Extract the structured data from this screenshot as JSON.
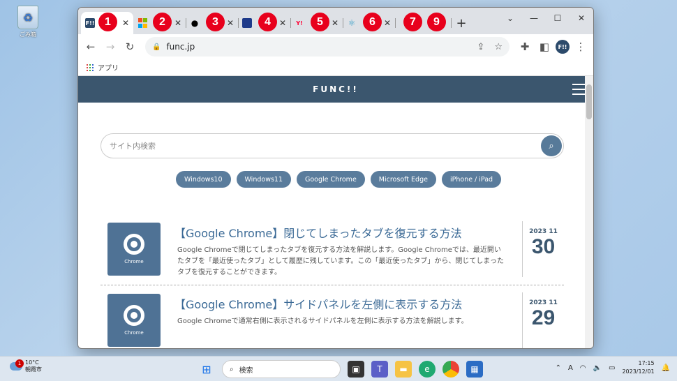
{
  "desktop": {
    "recycle_label": "ごみ箱"
  },
  "browser": {
    "tabs": [
      {
        "fav": "F!!",
        "color": "#2c4a6b",
        "badge": "1"
      },
      {
        "fav": "",
        "color": "#f25022",
        "badge": "2"
      },
      {
        "fav": "",
        "color": "#000000",
        "badge": "3"
      },
      {
        "fav": "",
        "color": "#1e3a8a",
        "badge": "4"
      },
      {
        "fav": "Y!",
        "color": "#ff0033",
        "badge": "5"
      },
      {
        "fav": "⚛",
        "color": "#61dafb",
        "badge": "6"
      },
      {
        "fav": "",
        "color": "#888888",
        "badge": "7"
      },
      {
        "fav": "",
        "color": "#888888",
        "badge": "9"
      }
    ],
    "new_tab": "+",
    "url": "func.jp",
    "bookmark_apps": "アプリ",
    "profile": "F!!"
  },
  "site": {
    "logo": "FUNC!!",
    "search_placeholder": "サイト内検索",
    "tags": [
      "Windows10",
      "Windows11",
      "Google Chrome",
      "Microsoft Edge",
      "iPhone / iPad"
    ],
    "articles": [
      {
        "title": "【Google Chrome】閉じてしまったタブを復元する方法",
        "desc": "Google Chromeで閉じてしまったタブを復元する方法を解説します。Google Chromeでは、最近開いたタブを「最近使ったタブ」として履歴に残しています。この「最近使ったタブ」から、閉じてしまったタブを復元することができます。",
        "ym": "2023 11",
        "day": "30",
        "thumb": "Chrome"
      },
      {
        "title": "【Google Chrome】サイドパネルを左側に表示する方法",
        "desc": "Google Chromeで通常右側に表示されるサイドパネルを左側に表示する方法を解説します。",
        "ym": "2023 11",
        "day": "29",
        "thumb": "Chrome"
      }
    ]
  },
  "taskbar": {
    "weather_temp": "10°C",
    "weather_city": "朝霞市",
    "weather_badge": "1",
    "search": "検索",
    "ime": "A",
    "time": "17:15",
    "date": "2023/12/01"
  }
}
